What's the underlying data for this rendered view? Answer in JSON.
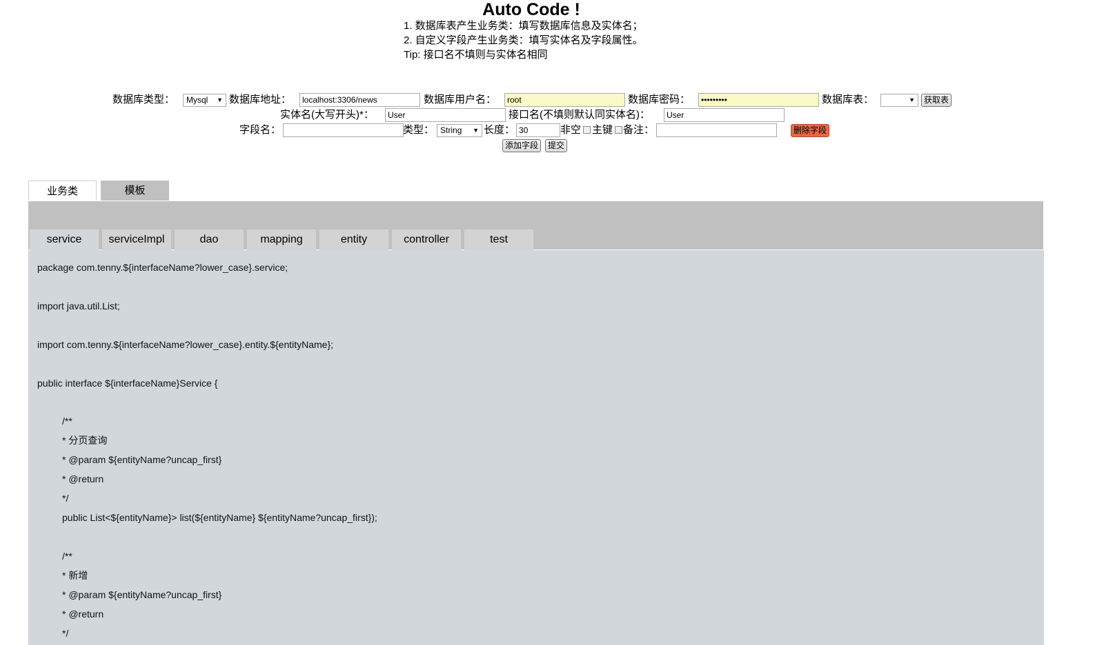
{
  "header": {
    "title": "Auto Code !",
    "lines": [
      "1. 数据库表产生业务类：填写数据库信息及实体名；",
      "2. 自定义字段产生业务类：填写实体名及字段属性。",
      "Tip: 接口名不填则与实体名相同"
    ]
  },
  "form": {
    "db_type_label": "数据库类型：",
    "db_type_value": "Mysql",
    "db_addr_label": "数据库地址：",
    "db_addr_value": "localhost:3306/news",
    "db_user_label": "数据库用户名：",
    "db_user_value": "root",
    "db_pwd_label": "数据库密码：",
    "db_pwd_value": "•••••••••",
    "db_table_label": "数据库表：",
    "db_table_value": "",
    "get_table_button": "获取表",
    "entity_label": "实体名(大写开头)*：",
    "entity_value": "User",
    "interface_label": "接口名(不填则默认同实体名)：",
    "interface_value": "User",
    "field_name_label": "字段名：",
    "field_name_value": "",
    "type_label": "类型：",
    "type_value": "String",
    "length_label": "长度：",
    "length_value": "30",
    "notnull_label": "非空",
    "primary_label": "主键",
    "remark_label": "备注：",
    "remark_value": "",
    "delete_field_button": "删除字段",
    "add_field_button": "添加字段",
    "submit_button": "提交"
  },
  "main_tabs": [
    "业务类",
    "模板"
  ],
  "template_tabs": [
    "service",
    "serviceImpl",
    "dao",
    "mapping",
    "entity",
    "controller",
    "test"
  ],
  "code_lines": [
    "package com.tenny.${interfaceName?lower_case}.service;",
    "import java.util.List;",
    "import com.tenny.${interfaceName?lower_case}.entity.${entityName};",
    "public interface ${interfaceName}Service {",
    "/**",
    " * 分页查询",
    " * @param ${entityName?uncap_first}",
    " * @return",
    " */",
    "public List<${entityName}> list(${entityName} ${entityName?uncap_first});",
    "/**",
    " * 新增",
    " * @param ${entityName?uncap_first}",
    " * @return",
    " */"
  ]
}
